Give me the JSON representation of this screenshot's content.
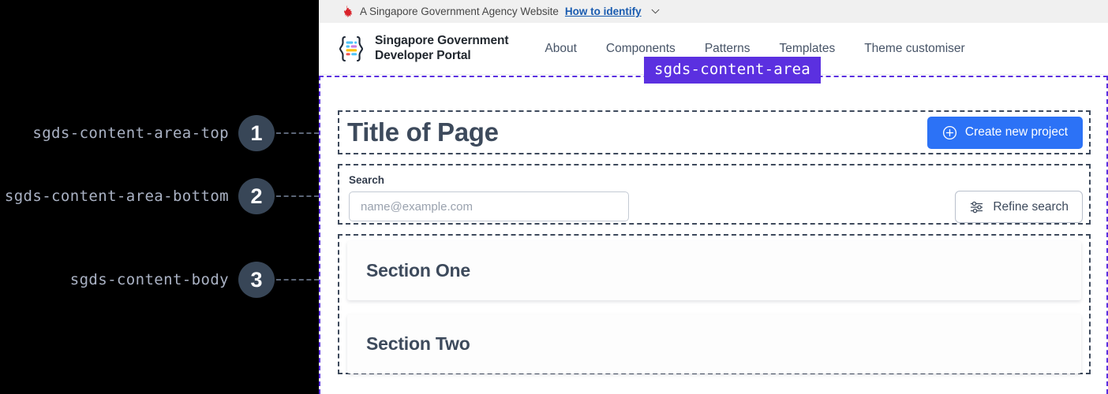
{
  "annotations": [
    {
      "num": "1",
      "label": "sgds-content-area-top"
    },
    {
      "num": "2",
      "label": "sgds-content-area-bottom"
    },
    {
      "num": "3",
      "label": "sgds-content-body"
    }
  ],
  "colors": {
    "accent_purple": "#5b30e0",
    "primary_blue": "#2c72f6",
    "slate": "#3d4a5c",
    "annotation_circle": "#384657",
    "annotation_label": "#aab2c4"
  },
  "masthead": {
    "crest_icon": "sg-lion-crest-icon",
    "text": "A Singapore Government Agency Website",
    "link": "How to identify",
    "chevron_icon": "chevron-down-icon"
  },
  "navbar": {
    "logo_icon": "sgds-braces-logo-icon",
    "brand": "Singapore Government\nDeveloper Portal",
    "links": [
      {
        "label": "About"
      },
      {
        "label": "Components"
      },
      {
        "label": "Patterns"
      },
      {
        "label": "Templates"
      },
      {
        "label": "Theme customiser"
      }
    ]
  },
  "content_area": {
    "badge": "sgds-content-area",
    "top": {
      "title": "Title of Page",
      "cta": {
        "label": "Create new project",
        "icon": "plus-circle-icon"
      }
    },
    "bottom": {
      "search_label": "Search",
      "search_value": "",
      "search_placeholder": "name@example.com",
      "refine": {
        "label": "Refine search",
        "icon": "sliders-icon"
      }
    },
    "body": {
      "cards": [
        {
          "title": "Section One"
        },
        {
          "title": "Section Two"
        }
      ]
    }
  }
}
